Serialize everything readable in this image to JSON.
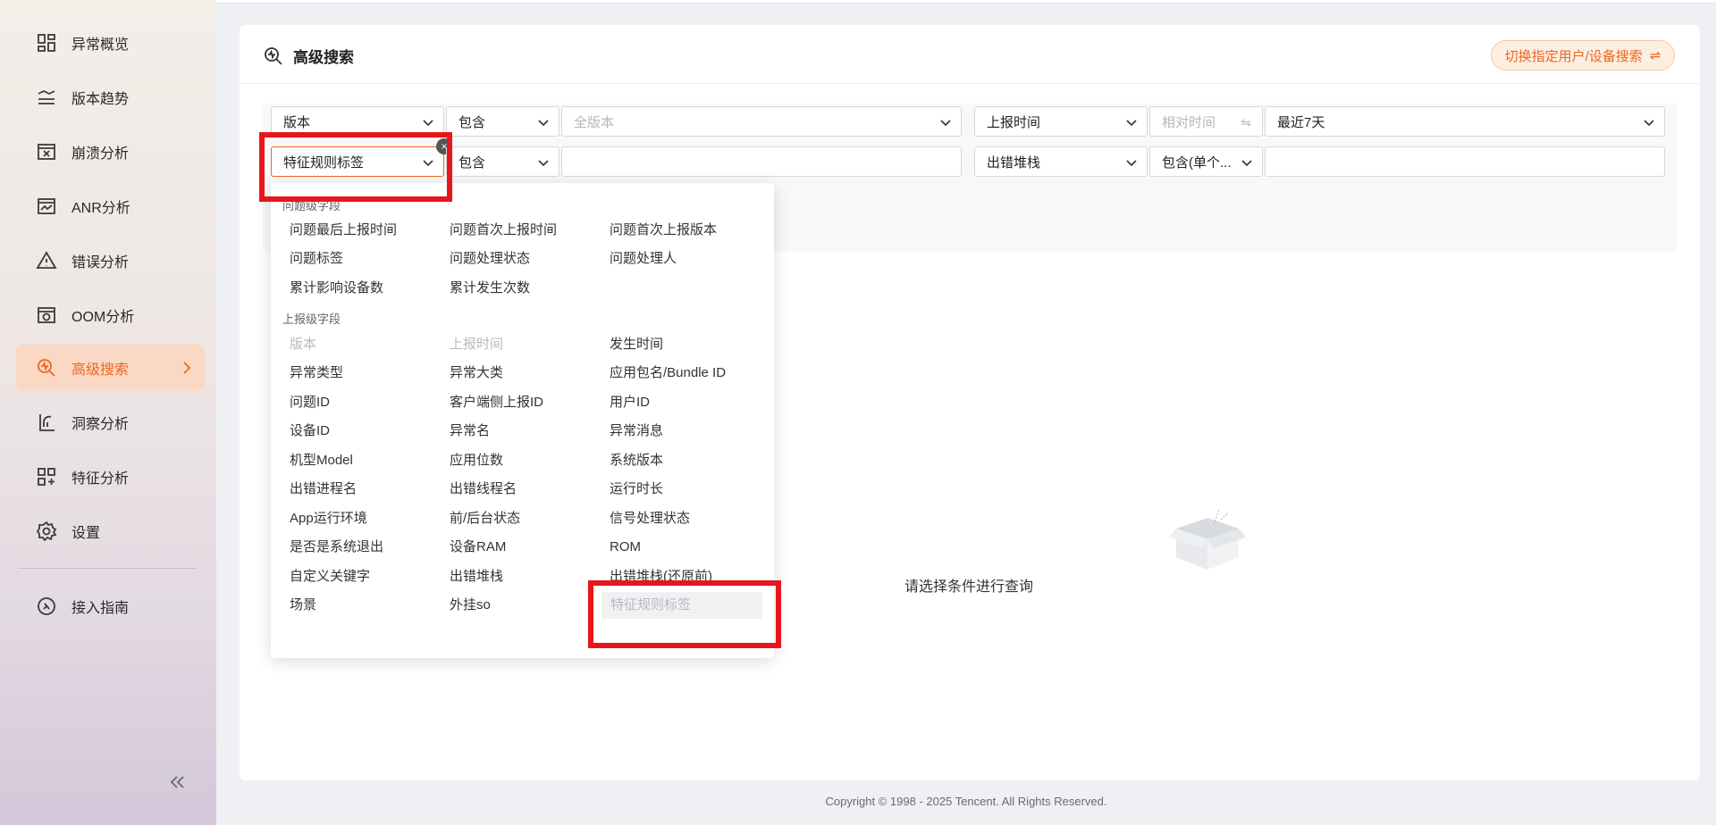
{
  "sidebar": {
    "items": [
      {
        "label": "异常概览",
        "icon": "dashboard-icon"
      },
      {
        "label": "版本趋势",
        "icon": "trend-icon"
      },
      {
        "label": "崩溃分析",
        "icon": "crash-icon"
      },
      {
        "label": "ANR分析",
        "icon": "anr-icon"
      },
      {
        "label": "错误分析",
        "icon": "warning-icon"
      },
      {
        "label": "OOM分析",
        "icon": "oom-icon"
      },
      {
        "label": "高级搜索",
        "icon": "advanced-search-icon",
        "active": true
      },
      {
        "label": "洞察分析",
        "icon": "insight-icon"
      },
      {
        "label": "特征分析",
        "icon": "feature-icon"
      },
      {
        "label": "设置",
        "icon": "gear-icon"
      },
      {
        "label": "接入指南",
        "icon": "compass-icon"
      }
    ]
  },
  "header": {
    "title": "高级搜索",
    "switch_label": "切换指定用户/设备搜索"
  },
  "filters": {
    "row1": {
      "field": "版本",
      "operator": "包含",
      "value_placeholder": "全版本",
      "time_field": "上报时间",
      "time_mode": "相对时间",
      "time_value": "最近7天"
    },
    "row2": {
      "field": "特征规则标签",
      "operator": "包含",
      "value": "",
      "field2": "出错堆栈",
      "operator2": "包含(单个...",
      "value2": ""
    }
  },
  "dropdown": {
    "group1_label": "问题级字段",
    "group1": [
      "问题最后上报时间",
      "问题首次上报时间",
      "问题首次上报版本",
      "问题标签",
      "问题处理状态",
      "问题处理人",
      "累计影响设备数",
      "累计发生次数"
    ],
    "group2_label": "上报级字段",
    "group2": [
      "版本",
      "上报时间",
      "发生时间",
      "异常类型",
      "异常大类",
      "应用包名/Bundle ID",
      "问题ID",
      "客户端侧上报ID",
      "用户ID",
      "设备ID",
      "异常名",
      "异常消息",
      "机型Model",
      "应用位数",
      "系统版本",
      "出错进程名",
      "出错线程名",
      "运行时长",
      "App运行环境",
      "前/后台状态",
      "信号处理状态",
      "是否是系统退出",
      "设备RAM",
      "ROM",
      "自定义关键字",
      "出错堆栈",
      "出错堆栈(还原前)",
      "场景",
      "外挂so",
      "特征规则标签"
    ],
    "disabled": [
      "版本",
      "上报时间"
    ],
    "selected": "特征规则标签"
  },
  "empty_state": {
    "text": "请选择条件进行查询",
    "icon": "empty-box-icon"
  },
  "footer": "Copyright © 1998 - 2025 Tencent. All Rights Reserved.",
  "colors": {
    "accent": "#f0661e",
    "highlight": "#e8161b"
  }
}
